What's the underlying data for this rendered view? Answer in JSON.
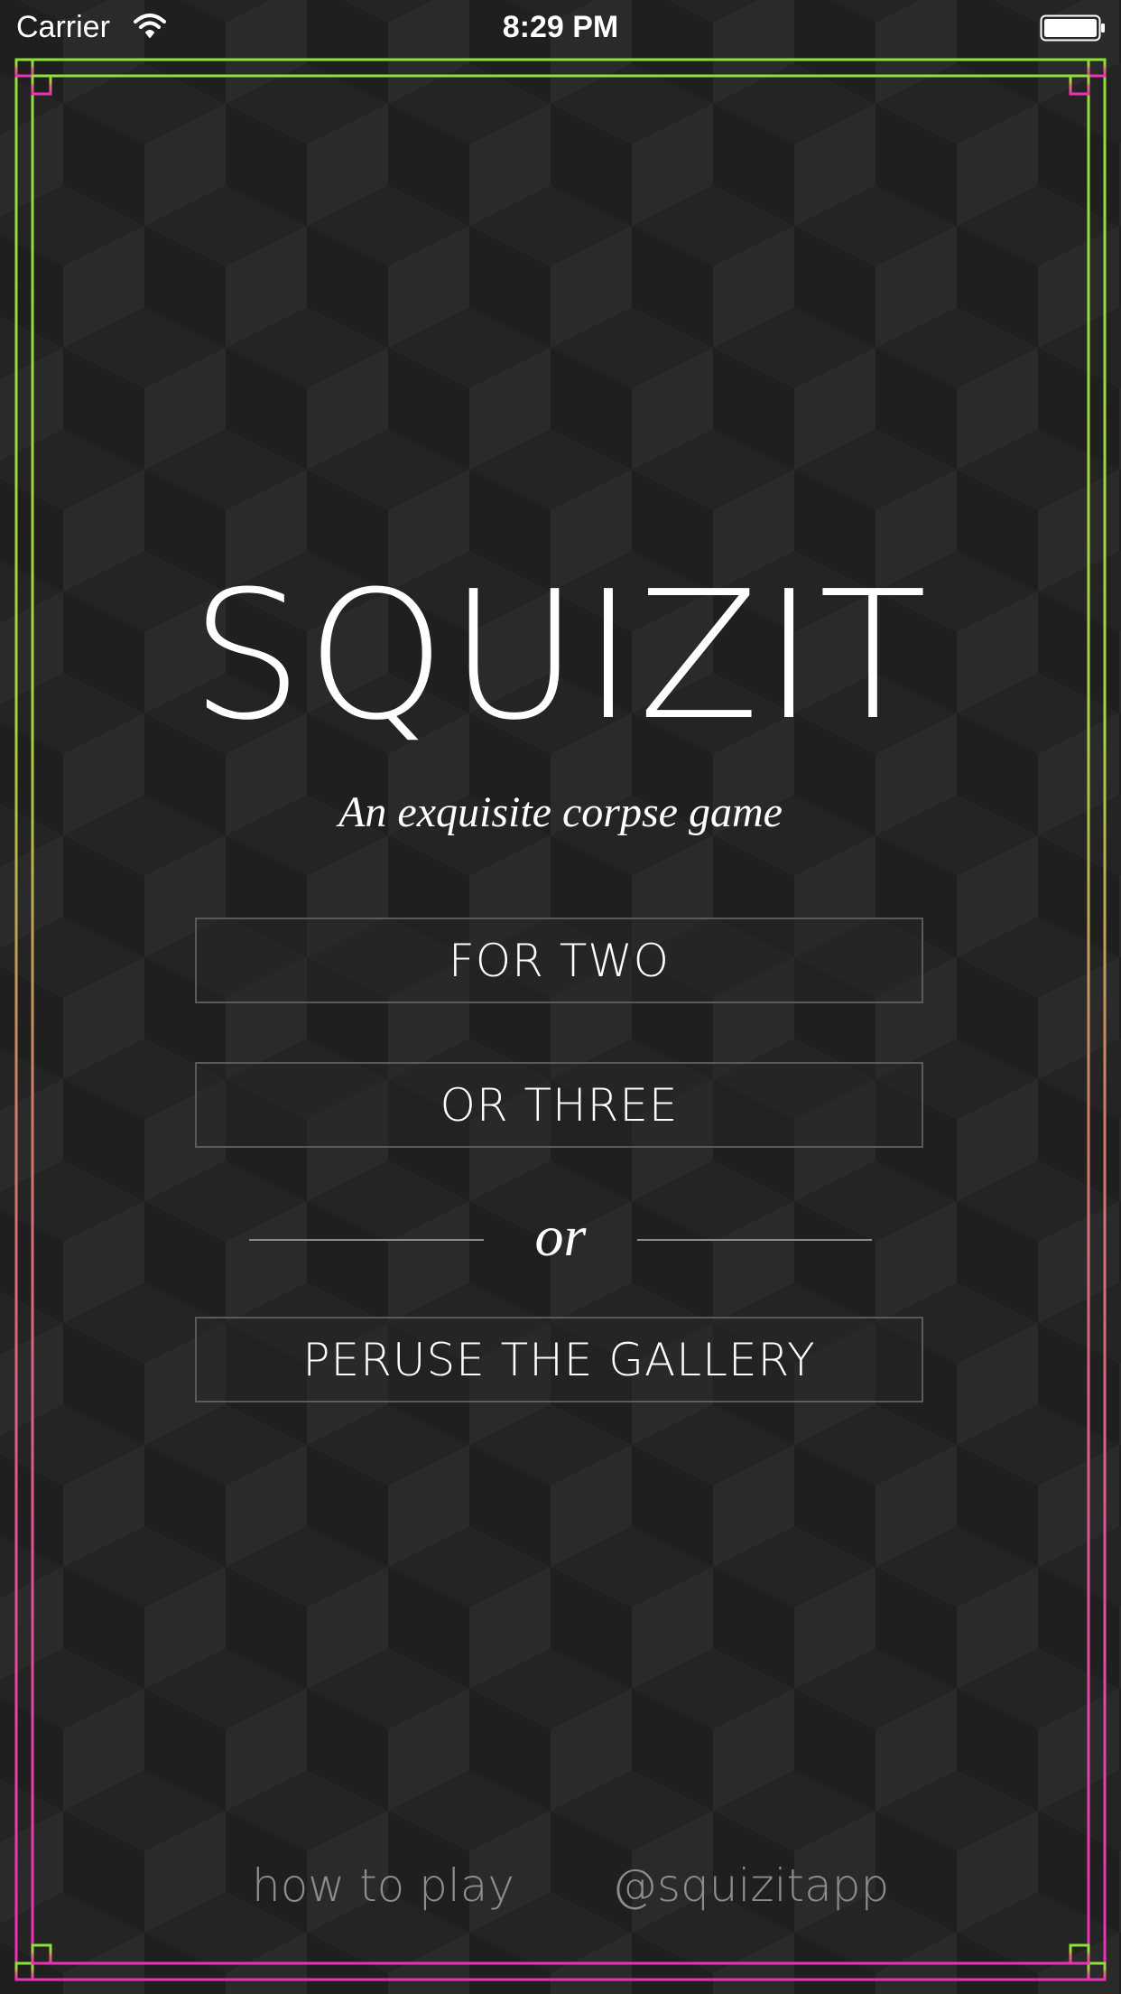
{
  "status_bar": {
    "carrier": "Carrier",
    "time": "8:29 PM",
    "icons": [
      "wifi-icon",
      "battery-icon"
    ]
  },
  "title": "SQUIZIT",
  "subtitle": "An exquisite corpse game",
  "buttons": {
    "for_two": "FOR TWO",
    "or_three": "OR THREE",
    "gallery": "PERUSE THE GALLERY"
  },
  "divider_text": "or",
  "footer": {
    "how_to_play": "how to play",
    "handle": "@squizitapp"
  },
  "colors": {
    "background": "#242424",
    "frame_top": "#8ee03a",
    "frame_bottom": "#ee2fb8",
    "button_border": "#5a5a5a",
    "footer_text": "#8d8d8d"
  }
}
